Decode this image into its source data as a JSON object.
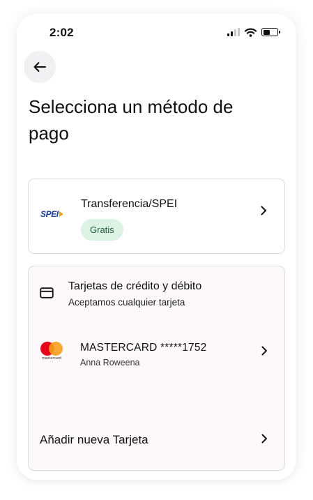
{
  "status_bar": {
    "time": "2:02",
    "icons": [
      "signal-icon",
      "wifi-icon",
      "battery-icon"
    ],
    "battery_level": 0.5
  },
  "header": {
    "back_icon": "arrow-left-icon",
    "title": "Selecciona un método de pago"
  },
  "spei": {
    "logo_text": "SPEI",
    "label": "Transferencia/SPEI",
    "badge": "Gratis"
  },
  "cards_section": {
    "icon": "credit-card-icon",
    "title": "Tarjetas de crédito y débito",
    "subtitle": "Aceptamos cualquier tarjeta",
    "saved_card": {
      "brand_logo_text": "mastercard",
      "title": "MASTERCARD *****1752",
      "holder": "Anna Roweena"
    },
    "add_label": "Añadir nueva Tarjeta"
  },
  "colors": {
    "badge_bg": "#dcf3e4",
    "badge_text": "#245a3a",
    "spei_blue": "#1f3f91",
    "mc_red": "#eb001b",
    "mc_orange": "#f79e1b",
    "section_bg": "#fdf9fb"
  }
}
